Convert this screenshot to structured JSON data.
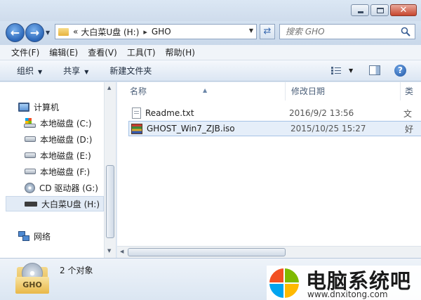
{
  "window": {
    "min_glyph": "",
    "close_glyph": "✕"
  },
  "nav": {
    "back_glyph": "←",
    "forward_glyph": "→"
  },
  "address": {
    "overflow": "«",
    "crumbs": [
      "大白菜U盘 (H:)",
      "GHO"
    ]
  },
  "search": {
    "placeholder": "搜索 GHO"
  },
  "menu": [
    "文件(F)",
    "编辑(E)",
    "查看(V)",
    "工具(T)",
    "帮助(H)"
  ],
  "commands": {
    "organize": "组织",
    "share": "共享",
    "new_folder": "新建文件夹"
  },
  "help_glyph": "?",
  "tree": {
    "computer": "计算机",
    "drives": [
      {
        "label": "本地磁盘 (C:)",
        "icon": "system-drive-icon"
      },
      {
        "label": "本地磁盘 (D:)",
        "icon": "drive-icon"
      },
      {
        "label": "本地磁盘 (E:)",
        "icon": "drive-icon"
      },
      {
        "label": "本地磁盘 (F:)",
        "icon": "drive-icon"
      },
      {
        "label": "CD 驱动器 (G:)",
        "icon": "cd-drive-icon"
      },
      {
        "label": "大白菜U盘 (H:)",
        "icon": "usb-drive-icon",
        "selected": true
      }
    ],
    "network": "网络"
  },
  "columns": {
    "name": "名称",
    "modified": "修改日期",
    "type": "类"
  },
  "files": [
    {
      "name": "Readme.txt",
      "modified": "2016/9/2 13:56",
      "type": "文",
      "icon": "text-file-icon"
    },
    {
      "name": "GHOST_Win7_ZJB.iso",
      "modified": "2015/10/25 15:27",
      "type": "好",
      "icon": "iso-file-icon",
      "selected": true
    }
  ],
  "details": {
    "folder_label": "GHO",
    "count": "2 个对象"
  },
  "watermark": {
    "title": "电脑系统吧",
    "url": "www.dnxitong.com"
  },
  "colors": {
    "accent": "#2a66b8",
    "selection": "#e5eef9"
  }
}
